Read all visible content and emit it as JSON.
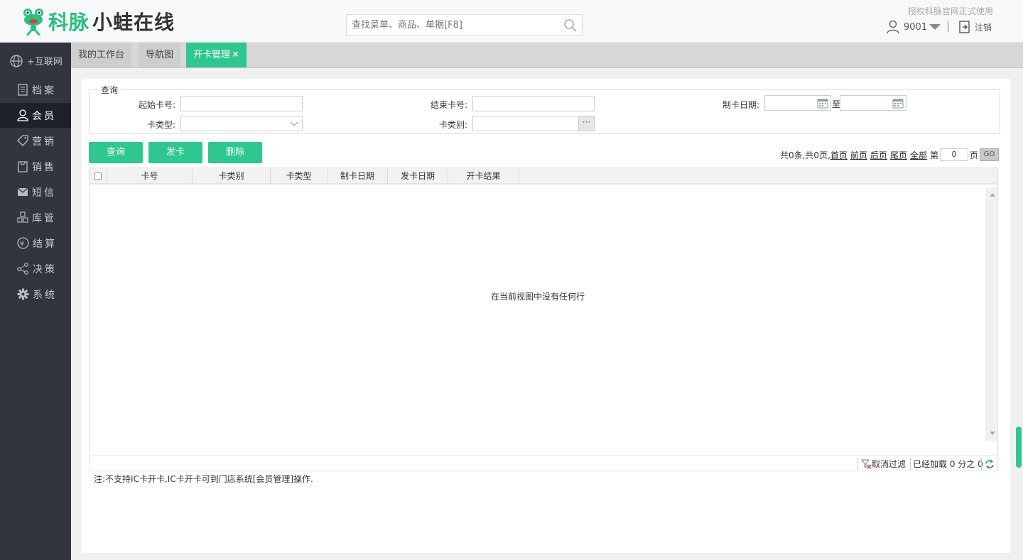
{
  "header": {
    "logo_brand": "科脉",
    "logo_product": "小蛙在线",
    "search_placeholder": "查找菜单、商品、单据[F8]",
    "auth_notice": "授权科脉官网正式使用",
    "username": "9001",
    "logout_label": "注销"
  },
  "sidebar": {
    "items": [
      {
        "label": "+互联网",
        "icon": "globe-icon"
      },
      {
        "label": "档案",
        "icon": "document-icon"
      },
      {
        "label": "会员",
        "icon": "user-icon"
      },
      {
        "label": "营销",
        "icon": "tag-icon"
      },
      {
        "label": "销售",
        "icon": "bag-icon"
      },
      {
        "label": "短信",
        "icon": "mail-icon"
      },
      {
        "label": "库管",
        "icon": "boxes-icon"
      },
      {
        "label": "结算",
        "icon": "yen-icon"
      },
      {
        "label": "决策",
        "icon": "share-icon"
      },
      {
        "label": "系统",
        "icon": "gear-icon"
      }
    ],
    "active": "会员"
  },
  "tabs": [
    {
      "label": "我的工作台"
    },
    {
      "label": "导航图"
    },
    {
      "label": "开卡管理",
      "closable": true
    }
  ],
  "query": {
    "legend": "查询",
    "start_card_label": "起始卡号:",
    "end_card_label": "结束卡号:",
    "make_date_label": "制卡日期:",
    "to_label": "至",
    "card_type_label": "卡类型:",
    "card_category_label": "卡类别:",
    "ellipsis": "···"
  },
  "buttons": {
    "query": "查询",
    "issue": "发卡",
    "delete": "删除"
  },
  "pager": {
    "summary": "共0条,共0页,",
    "first": "首页",
    "prev": "前页",
    "next": "后页",
    "last": "尾页",
    "all": "全部",
    "page_prefix": "第",
    "page_value": "0",
    "page_suffix": "页",
    "go": "GO"
  },
  "grid": {
    "columns": [
      "卡号",
      "卡类别",
      "卡类型",
      "制卡日期",
      "发卡日期",
      "开卡结果"
    ],
    "empty_text": "在当前视图中没有任何行",
    "footer": {
      "clear_filter": "取消过滤",
      "loaded": "已经加载 0 分之 0"
    }
  },
  "note": "注:不支持IC卡开卡,IC卡开卡可到门店系统[会员管理]操作.",
  "colors": {
    "accent": "#2fc790",
    "sidebar_bg": "#323440",
    "sidebar_active": "#1f212a"
  }
}
